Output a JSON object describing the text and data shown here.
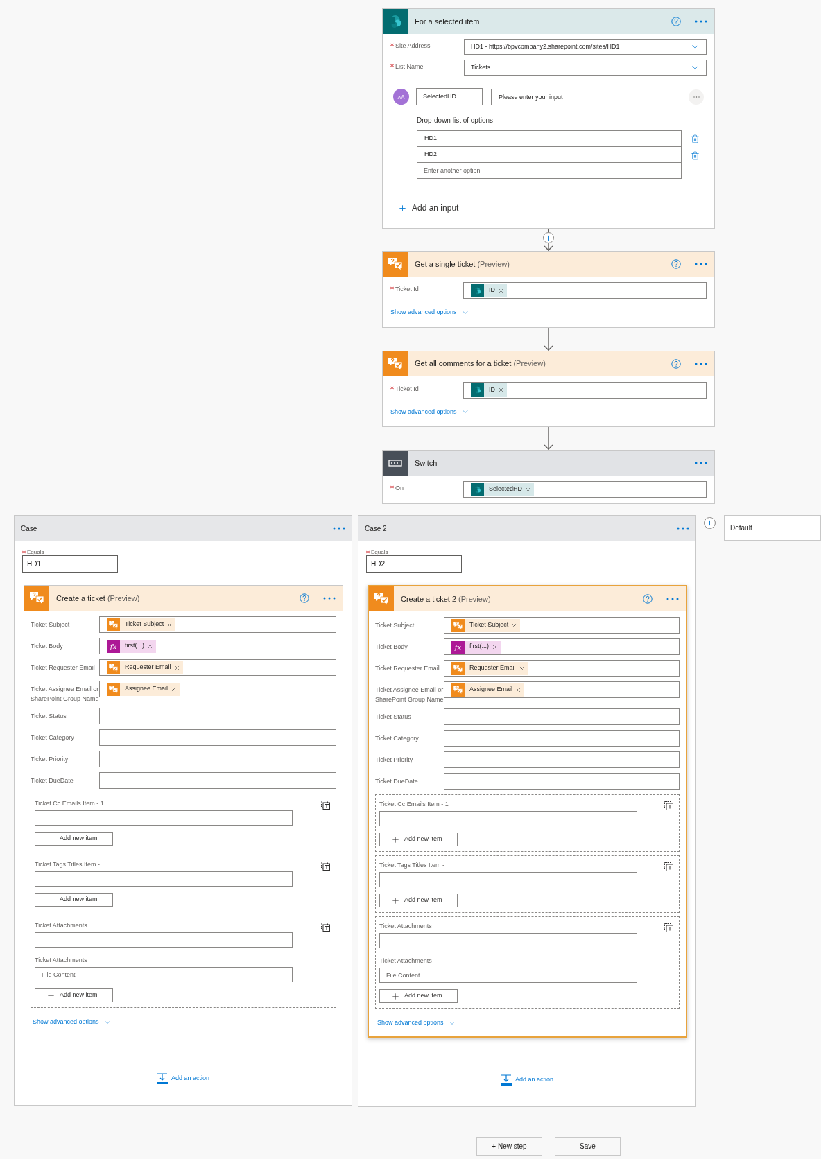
{
  "trigger": {
    "title": "For a selected item",
    "kind": "sharepoint",
    "fields": [
      {
        "label": "Site Address",
        "required": true,
        "value": "HD1 - https://bpvcompany2.sharepoint.com/sites/HD1"
      },
      {
        "label": "List Name",
        "required": true,
        "value": "Tickets"
      }
    ],
    "input": {
      "name": "SelectedHD",
      "placeholder": "Please enter your input",
      "options_label": "Drop-down list of options",
      "options": [
        "HD1",
        "HD2"
      ],
      "option_placeholder": "Enter another option"
    },
    "add_input": "Add an input"
  },
  "steps": [
    {
      "title": "Get a single ticket",
      "note": "(Preview)",
      "kind": "ticket",
      "fields": [
        {
          "label": "Ticket Id",
          "required": true,
          "tokens": [
            {
              "kind": "list",
              "text": "ID"
            }
          ]
        }
      ],
      "advanced": "Show advanced options"
    },
    {
      "title": "Get all comments for a ticket",
      "note": "(Preview)",
      "kind": "ticket",
      "fields": [
        {
          "label": "Ticket Id",
          "required": true,
          "tokens": [
            {
              "kind": "list",
              "text": "ID"
            }
          ]
        }
      ],
      "advanced": "Show advanced options"
    },
    {
      "title": "Switch",
      "kind": "control",
      "fields": [
        {
          "label": "On",
          "required": true,
          "tokens": [
            {
              "kind": "list",
              "text": "SelectedHD"
            }
          ]
        }
      ]
    }
  ],
  "cases": [
    {
      "title": "Case",
      "equals_label": "Equals",
      "equals_value": "HD1",
      "add_action": "Add an action",
      "action": {
        "title": "Create a ticket",
        "note": "(Preview)",
        "selected": false,
        "fields": [
          {
            "label": "Ticket Subject",
            "tokens": [
              {
                "kind": "ticket",
                "text": "Ticket Subject"
              }
            ]
          },
          {
            "label": "Ticket Body",
            "tokens": [
              {
                "kind": "expression",
                "icon_text": "fx",
                "text": "first(...)"
              }
            ]
          },
          {
            "label": "Ticket Requester Email",
            "tokens": [
              {
                "kind": "ticket",
                "text": "Requester Email"
              }
            ]
          },
          {
            "label": "Ticket Assignee Email or SharePoint Group Name",
            "tokens": [
              {
                "kind": "ticket",
                "text": "Assignee Email"
              }
            ]
          },
          {
            "label": "Ticket Status"
          },
          {
            "label": "Ticket Category"
          },
          {
            "label": "Ticket Priority"
          },
          {
            "label": "Ticket DueDate"
          }
        ],
        "arrays": [
          {
            "fields": [
              {
                "label": "Ticket Cc Emails Item - 1"
              }
            ],
            "button": "Add new item"
          },
          {
            "fields": [
              {
                "label": "Ticket Tags Titles Item -"
              }
            ],
            "button": "Add new item"
          },
          {
            "fields": [
              {
                "label": "Ticket Attachments"
              },
              {
                "label": "Ticket Attachments",
                "placeholder": "File Content"
              }
            ],
            "button": "Add new item"
          }
        ],
        "advanced": "Show advanced options"
      }
    },
    {
      "title": "Case 2",
      "equals_label": "Equals",
      "equals_value": "HD2",
      "add_action": "Add an action",
      "action": {
        "title": "Create a ticket 2",
        "note": "(Preview)",
        "selected": true,
        "fields": [
          {
            "label": "Ticket Subject",
            "tokens": [
              {
                "kind": "ticket",
                "text": "Ticket Subject"
              }
            ]
          },
          {
            "label": "Ticket Body",
            "tokens": [
              {
                "kind": "expression",
                "icon_text": "fx",
                "text": "first(...)"
              }
            ]
          },
          {
            "label": "Ticket Requester Email",
            "tokens": [
              {
                "kind": "ticket",
                "text": "Requester Email"
              }
            ]
          },
          {
            "label": "Ticket Assignee Email or SharePoint Group Name",
            "tokens": [
              {
                "kind": "ticket",
                "text": "Assignee Email"
              }
            ]
          },
          {
            "label": "Ticket Status"
          },
          {
            "label": "Ticket Category"
          },
          {
            "label": "Ticket Priority"
          },
          {
            "label": "Ticket DueDate"
          }
        ],
        "arrays": [
          {
            "fields": [
              {
                "label": "Ticket Cc Emails Item - 1"
              }
            ],
            "button": "Add new item"
          },
          {
            "fields": [
              {
                "label": "Ticket Tags Titles Item -"
              }
            ],
            "button": "Add new item"
          },
          {
            "fields": [
              {
                "label": "Ticket Attachments"
              },
              {
                "label": "Ticket Attachments",
                "placeholder": "File Content"
              }
            ],
            "button": "Add new item"
          }
        ],
        "advanced": "Show advanced options"
      }
    }
  ],
  "default": {
    "title": "Default"
  },
  "buttons": [
    "+ New step",
    "Save"
  ]
}
